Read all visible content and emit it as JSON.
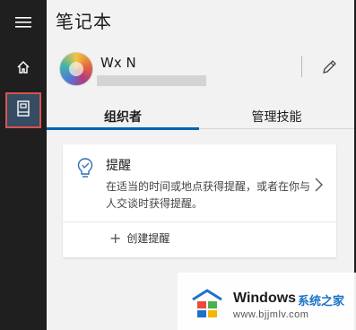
{
  "app": {
    "title": "笔记本"
  },
  "rail": {
    "items": [
      {
        "icon": "hamburger-icon"
      },
      {
        "icon": "home-icon"
      },
      {
        "icon": "notebook-icon",
        "selected": true
      }
    ]
  },
  "user": {
    "name": "Wx N"
  },
  "tabs": [
    {
      "label": "组织者",
      "selected": true
    },
    {
      "label": "管理技能",
      "selected": false
    }
  ],
  "reminder_card": {
    "title": "提醒",
    "description": "在适当的时间或地点获得提醒，或者在你与人交谈时获得提醒。",
    "action_label": "创建提醒",
    "action_icon": "plus-icon"
  },
  "watermark": {
    "brand": "Windows",
    "brand_cn": "系统之家",
    "url": "www.bjjmlv.com"
  },
  "colors": {
    "accent": "#0063b1",
    "rail_bg": "#1f1f1f",
    "selection_outline": "#d9534f"
  }
}
